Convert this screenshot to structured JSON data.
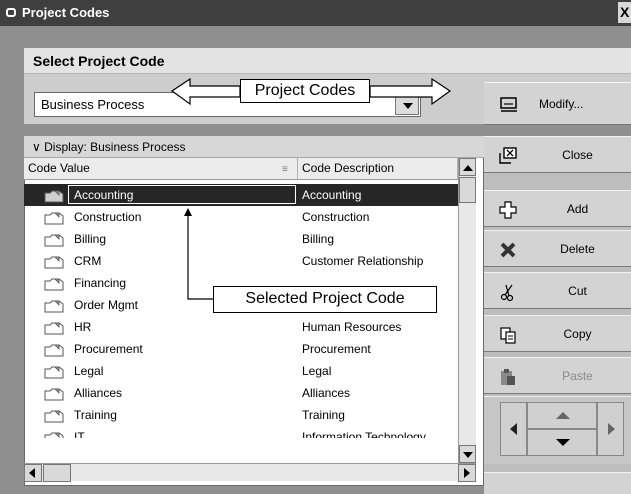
{
  "window": {
    "title": "Project Codes",
    "close_glyph": "X"
  },
  "section": {
    "title": "Select Project Code"
  },
  "combo": {
    "value": "Business Process"
  },
  "callouts": {
    "codes": "Project Codes",
    "selected": "Selected Project Code"
  },
  "modify_button": {
    "label": "Modify..."
  },
  "list": {
    "group_header": "∨ Display: Business Process",
    "col_value": "Code Value",
    "col_desc": "Code Description",
    "rows": [
      {
        "value": "Accounting",
        "desc": "Accounting",
        "selected": true
      },
      {
        "value": "Construction",
        "desc": "Construction"
      },
      {
        "value": "Billing",
        "desc": "Billing"
      },
      {
        "value": "CRM",
        "desc": "Customer Relationship"
      },
      {
        "value": "Financing",
        "desc": ""
      },
      {
        "value": "Order Mgmt",
        "desc": "Order Management"
      },
      {
        "value": "HR",
        "desc": "Human Resources"
      },
      {
        "value": "Procurement",
        "desc": "Procurement"
      },
      {
        "value": "Legal",
        "desc": "Legal"
      },
      {
        "value": "Alliances",
        "desc": "Alliances"
      },
      {
        "value": "Training",
        "desc": "Training"
      },
      {
        "value": "IT",
        "desc": "Information Technology"
      }
    ]
  },
  "actions": {
    "close": "Close",
    "add": "Add",
    "delete": "Delete",
    "cut": "Cut",
    "copy": "Copy",
    "paste": "Paste"
  },
  "icons": {
    "window": "window-icon",
    "modify": "modify-icon",
    "close": "close-icon",
    "add": "add-icon",
    "delete": "delete-icon",
    "cut": "scissors-icon",
    "copy": "copy-icon",
    "paste": "paste-icon",
    "row": "code-folder-icon"
  },
  "colors": {
    "selection": "#262626",
    "titlebar": "#3f3f3f"
  }
}
